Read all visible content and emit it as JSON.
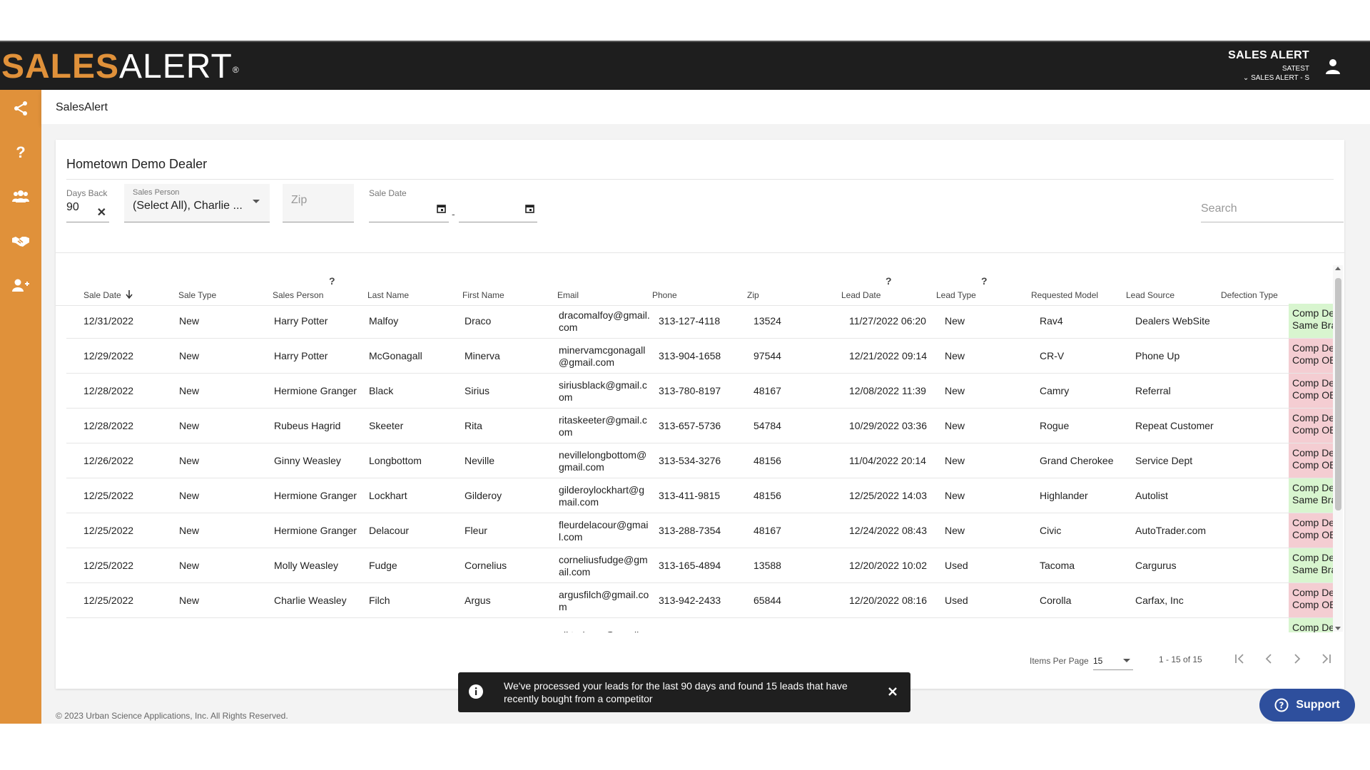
{
  "header": {
    "logo_part1": "SALES",
    "logo_part2": "ALERT",
    "logo_reg": "®",
    "app_name": "SALES ALERT",
    "dealer_code": "SATEST",
    "account_selector": "SALES ALERT - S"
  },
  "breadcrumb": "SalesAlert",
  "dealer_title": "Hometown Demo Dealer",
  "filters": {
    "days_back_label": "Days Back",
    "days_back_value": "90",
    "sales_person_label": "Sales Person",
    "sales_person_value": "(Select All), Charlie ...",
    "zip_placeholder": "Zip",
    "sale_date_label": "Sale Date",
    "date_separator": "-",
    "search_placeholder": "Search"
  },
  "table": {
    "columns": [
      "Sale Date",
      "Sale Type",
      "Sales Person",
      "Last Name",
      "First Name",
      "Email",
      "Phone",
      "Zip",
      "Lead Date",
      "Lead Type",
      "Requested Model",
      "Lead Source",
      "Defection Type"
    ],
    "help_marker": "?",
    "rows": [
      {
        "sale_date": "12/31/2022",
        "sale_type": "New",
        "sales_person": "Harry Potter",
        "last_name": "Malfoy",
        "first_name": "Draco",
        "email": "dracomalfoy@gmail.com",
        "phone": "313-127-4118",
        "zip": "13524",
        "lead_date": "11/27/2022 06:20",
        "lead_type": "New",
        "model": "Rav4",
        "source": "Dealers WebSite",
        "defection": "Comp Dealer Sale – Same Brand",
        "defection_color": "#d8f5cf"
      },
      {
        "sale_date": "12/29/2022",
        "sale_type": "New",
        "sales_person": "Harry Potter",
        "last_name": "McGonagall",
        "first_name": "Minerva",
        "email": "minervamcgonagall@gmail.com",
        "phone": "313-904-1658",
        "zip": "97544",
        "lead_date": "12/21/2022 09:14",
        "lead_type": "New",
        "model": "CR-V",
        "source": "Phone Up",
        "defection": "Comp Dealer Sale – Comp OEM",
        "defection_color": "#f4cdd2"
      },
      {
        "sale_date": "12/28/2022",
        "sale_type": "New",
        "sales_person": "Hermione Granger",
        "last_name": "Black",
        "first_name": "Sirius",
        "email": "siriusblack@gmail.com",
        "phone": "313-780-8197",
        "zip": "48167",
        "lead_date": "12/08/2022 11:39",
        "lead_type": "New",
        "model": "Camry",
        "source": "Referral",
        "defection": "Comp Dealer Sale – Comp OEM",
        "defection_color": "#f4cdd2"
      },
      {
        "sale_date": "12/28/2022",
        "sale_type": "New",
        "sales_person": "Rubeus Hagrid",
        "last_name": "Skeeter",
        "first_name": "Rita",
        "email": "ritaskeeter@gmail.com",
        "phone": "313-657-5736",
        "zip": "54784",
        "lead_date": "10/29/2022 03:36",
        "lead_type": "New",
        "model": "Rogue",
        "source": "Repeat Customer",
        "defection": "Comp Dealer Sale – Comp OEM",
        "defection_color": "#f4cdd2"
      },
      {
        "sale_date": "12/26/2022",
        "sale_type": "New",
        "sales_person": "Ginny Weasley",
        "last_name": "Longbottom",
        "first_name": "Neville",
        "email": "nevillelongbottom@gmail.com",
        "phone": "313-534-3276",
        "zip": "48156",
        "lead_date": "11/04/2022 20:14",
        "lead_type": "New",
        "model": "Grand Cherokee",
        "source": "Service Dept",
        "defection": "Comp Dealer Sale – Comp OEM",
        "defection_color": "#f4cdd2"
      },
      {
        "sale_date": "12/25/2022",
        "sale_type": "New",
        "sales_person": "Hermione Granger",
        "last_name": "Lockhart",
        "first_name": "Gilderoy",
        "email": "gilderoylockhart@gmail.com",
        "phone": "313-411-9815",
        "zip": "48156",
        "lead_date": "12/25/2022 14:03",
        "lead_type": "New",
        "model": "Highlander",
        "source": "Autolist",
        "defection": "Comp Dealer Sale – Same Brand",
        "defection_color": "#d8f5cf"
      },
      {
        "sale_date": "12/25/2022",
        "sale_type": "New",
        "sales_person": "Hermione Granger",
        "last_name": "Delacour",
        "first_name": "Fleur",
        "email": "fleurdelacour@gmail.com",
        "phone": "313-288-7354",
        "zip": "48167",
        "lead_date": "12/24/2022 08:43",
        "lead_type": "New",
        "model": "Civic",
        "source": "AutoTrader.com",
        "defection": "Comp Dealer Sale – Comp OEM",
        "defection_color": "#f4cdd2"
      },
      {
        "sale_date": "12/25/2022",
        "sale_type": "New",
        "sales_person": "Molly Weasley",
        "last_name": "Fudge",
        "first_name": "Cornelius",
        "email": "corneliusfudge@gmail.com",
        "phone": "313-165-4894",
        "zip": "13588",
        "lead_date": "12/20/2022 10:02",
        "lead_type": "Used",
        "model": "Tacoma",
        "source": "Cargurus",
        "defection": "Comp Dealer Sale – Same Brand",
        "defection_color": "#d8f5cf"
      },
      {
        "sale_date": "12/25/2022",
        "sale_type": "New",
        "sales_person": "Charlie Weasley",
        "last_name": "Filch",
        "first_name": "Argus",
        "email": "argusfilch@gmail.com",
        "phone": "313-942-2433",
        "zip": "65844",
        "lead_date": "12/20/2022 08:16",
        "lead_type": "Used",
        "model": "Corolla",
        "source": "Carfax, Inc",
        "defection": "Comp Dealer Sale – Comp OEM",
        "defection_color": "#f4cdd2"
      },
      {
        "sale_date": "",
        "sale_type": "",
        "sales_person": "",
        "last_name": "",
        "first_name": "",
        "email": "viktorkrum@gmail.c",
        "phone": "",
        "zip": "",
        "lead_date": "",
        "lead_type": "",
        "model": "",
        "source": "",
        "defection": "Comp Dealer Sale –",
        "defection_color": "#d8f5cf"
      }
    ]
  },
  "pagination": {
    "items_per_page_label": "Items Per Page",
    "items_per_page_value": "15",
    "range": "1 - 15 of 15"
  },
  "footer": "© 2023 Urban Science Applications, Inc. All Rights Reserved.",
  "toast": {
    "message": "We've processed your leads for the last 90 days and found 15 leads that have recently bought from a competitor"
  },
  "support_label": "Support",
  "colors": {
    "brand_orange": "#e0913a",
    "header_dark": "#1e1e1e",
    "support_blue": "#2e4f9d",
    "same_brand_green": "#d8f5cf",
    "comp_oem_red": "#f4cdd2"
  }
}
